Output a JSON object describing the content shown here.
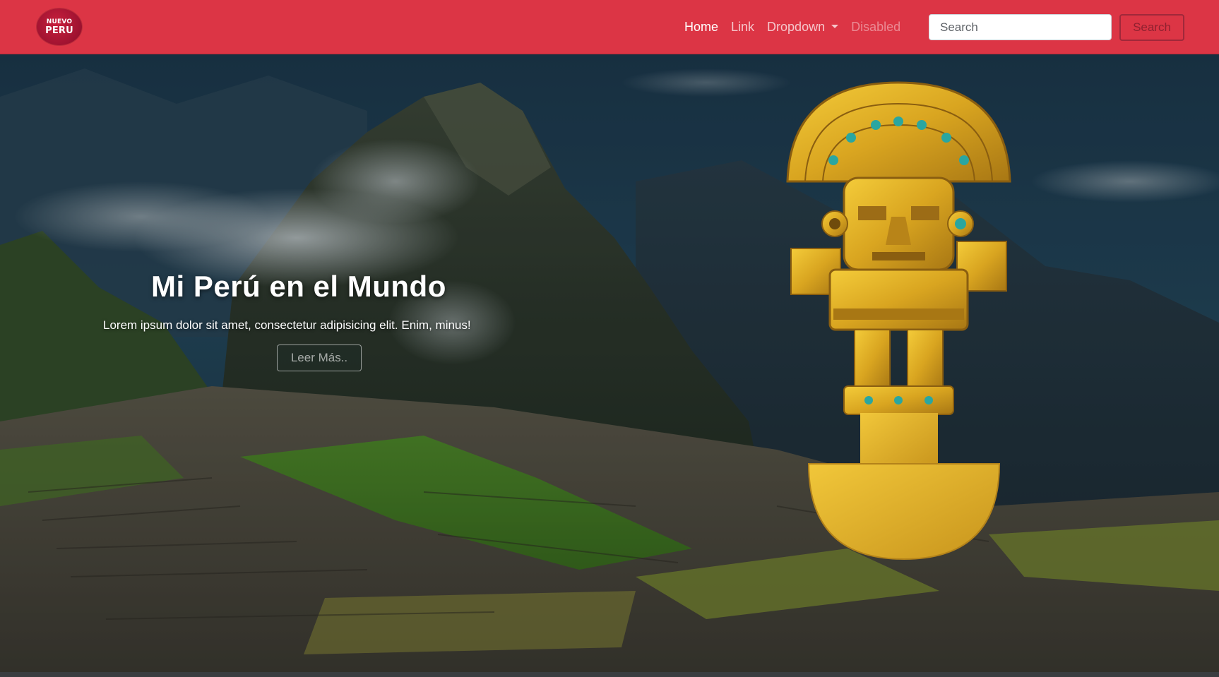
{
  "navbar": {
    "logo": {
      "line1": "NUEVO",
      "line2": "PERU"
    },
    "links": [
      {
        "label": "Home",
        "state": "active"
      },
      {
        "label": "Link",
        "state": "normal"
      },
      {
        "label": "Dropdown",
        "state": "normal"
      },
      {
        "label": "Disabled",
        "state": "disabled"
      }
    ],
    "search": {
      "placeholder": "Search",
      "value": "",
      "button_label": "Search"
    }
  },
  "hero": {
    "title": "Mi Perú en el Mundo",
    "subtitle": "Lorem ipsum dolor sit amet, consectetur adipisicing elit. Enim, minus!",
    "button_label": "Leer Más.."
  },
  "colors": {
    "navbar": "#dc3545",
    "gold": "#d9a520"
  },
  "icons": [
    "dropdown-caret-icon"
  ]
}
